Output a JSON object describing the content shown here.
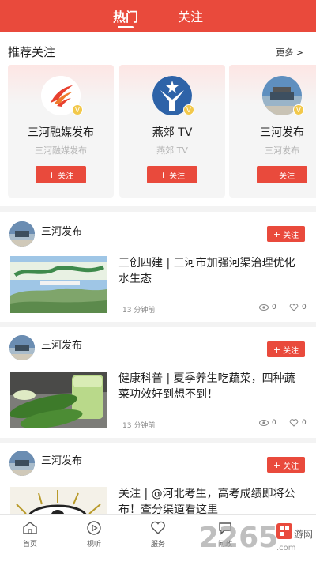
{
  "tabs": [
    {
      "label": "热门"
    },
    {
      "label": "关注"
    }
  ],
  "recommend": {
    "title": "推荐关注",
    "more": "更多 >",
    "cards": [
      {
        "name": "三河融媒发布",
        "sub": "三河融媒发布",
        "follow": "关注",
        "logo": "phoenix-logo"
      },
      {
        "name": "燕郊 TV",
        "sub": "燕郊 TV",
        "follow": "关注",
        "logo": "star-figure-logo"
      },
      {
        "name": "三河发布",
        "sub": "三河发布",
        "follow": "关注",
        "logo": "gate-photo-logo"
      }
    ]
  },
  "posts": [
    {
      "author": "三河发布",
      "follow": "关注",
      "title": "三创四建 | 三河市加强河渠治理优化水生态",
      "time": "13 分钟前",
      "views": "0",
      "likes": "0",
      "thumb": "landscape-banner"
    },
    {
      "author": "三河发布",
      "follow": "关注",
      "title": "健康科普 | 夏季养生吃蔬菜，四种蔬菜功效好到想不到！",
      "time": "13 分钟前",
      "views": "0",
      "likes": "0",
      "thumb": "cucumbers"
    },
    {
      "author": "三河发布",
      "follow": "关注",
      "title": "关注 | @河北考生，高考成绩即将公布！查分渠道看这里",
      "time": "",
      "views": "",
      "likes": "",
      "thumb": "eye-graphic"
    }
  ],
  "nav": [
    {
      "label": "首页",
      "icon": "home-icon"
    },
    {
      "label": "视听",
      "icon": "play-icon"
    },
    {
      "label": "服务",
      "icon": "heart-icon"
    },
    {
      "label": "问政",
      "icon": "chat-icon"
    }
  ],
  "watermark": {
    "text": "2265",
    "suffix": ".com",
    "tag": "游网"
  },
  "colors": {
    "accent": "#e94a3c",
    "badge": "#f2c84a"
  }
}
